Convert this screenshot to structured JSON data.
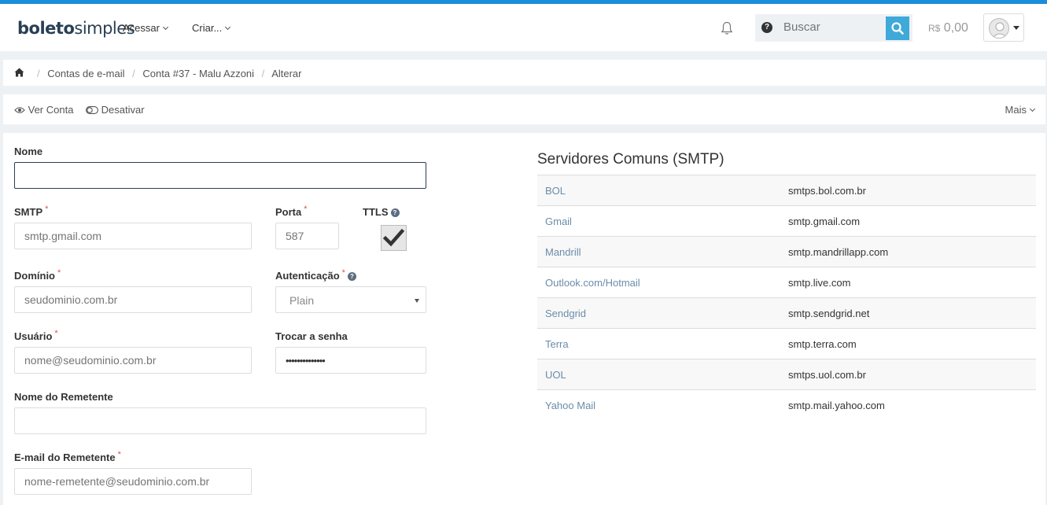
{
  "header": {
    "logo_part1": "boleto",
    "logo_part2": "simples",
    "menu_acessar": "Acessar",
    "menu_criar": "Criar...",
    "search_placeholder": "Buscar",
    "balance_currency": "R$",
    "balance_value": "0,00"
  },
  "breadcrumb": {
    "items": [
      "Contas de e-mail",
      "Conta #37 - Malu Azzoni",
      "Alterar"
    ]
  },
  "actions": {
    "ver_conta": "Ver Conta",
    "desativar": "Desativar",
    "mais": "Mais"
  },
  "form": {
    "nome_label": "Nome",
    "nome_value": "",
    "smtp_label": "SMTP",
    "smtp_placeholder": "smtp.gmail.com",
    "porta_label": "Porta",
    "porta_placeholder": "587",
    "ttls_label": "TTLS",
    "ttls_checked": true,
    "dominio_label": "Domínio",
    "dominio_placeholder": "seudominio.com.br",
    "autenticacao_label": "Autenticação",
    "autenticacao_value": "Plain",
    "usuario_label": "Usuário",
    "usuario_placeholder": "nome@seudominio.com.br",
    "trocar_senha_label": "Trocar a senha",
    "trocar_senha_value": "••••••••••••••",
    "remetente_label": "Nome do Remetente",
    "remetente_value": "",
    "email_remetente_label": "E-mail do Remetente",
    "email_remetente_placeholder": "nome-remetente@seudominio.com.br",
    "required_mark": "*"
  },
  "smtp_servers": {
    "title": "Servidores Comuns (SMTP)",
    "rows": [
      {
        "name": "BOL",
        "server": "smtps.bol.com.br"
      },
      {
        "name": "Gmail",
        "server": "smtp.gmail.com"
      },
      {
        "name": "Mandrill",
        "server": "smtp.mandrillapp.com"
      },
      {
        "name": "Outlook.com/Hotmail",
        "server": "smtp.live.com"
      },
      {
        "name": "Sendgrid",
        "server": "smtp.sendgrid.net"
      },
      {
        "name": "Terra",
        "server": "smtp.terra.com"
      },
      {
        "name": "UOL",
        "server": "smtps.uol.com.br"
      },
      {
        "name": "Yahoo Mail",
        "server": "smtp.mail.yahoo.com"
      }
    ]
  },
  "colors": {
    "accent": "#1a8ddb",
    "search_button": "#3fa9d9",
    "required": "#d9534f",
    "link": "#6b8caa"
  }
}
